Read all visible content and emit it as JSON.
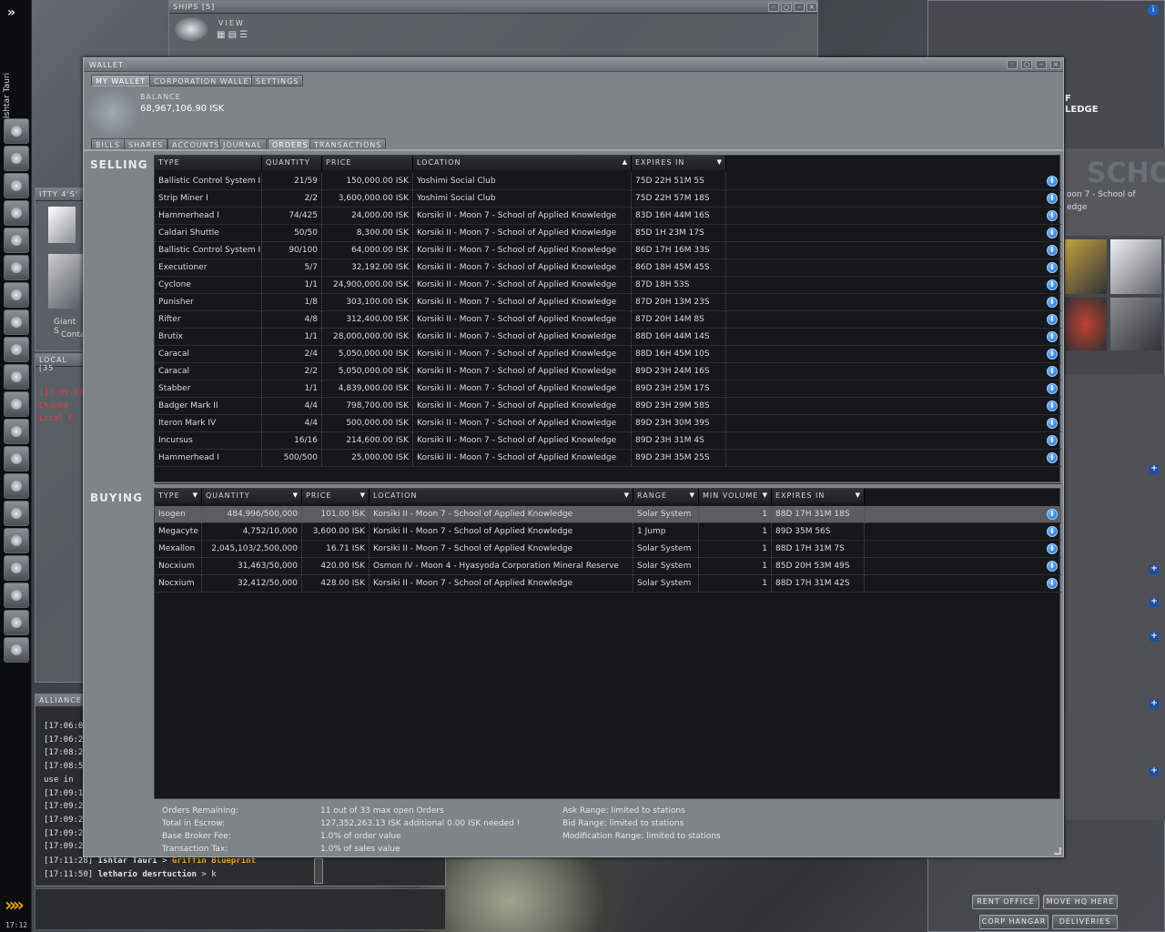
{
  "sidebar": {
    "expand_icon": "chevron-right-icon",
    "pilot_name": "Ishtar Tauri",
    "clock": "17:12"
  },
  "ships_window": {
    "title": "SHIPS [5]",
    "view_label": "VIEW"
  },
  "itty_panel": {
    "title": "ITTY 4'S'",
    "item_label": "Giant S",
    "item_label2": "Conta"
  },
  "local_panel": {
    "title": "LOCAL [35",
    "lines": [
      {
        "text": "[17:09:07",
        "color": "#e04040"
      },
      {
        "text": "Channe",
        "color": "#e04040"
      },
      {
        "text": "Local C",
        "color": "#e04040"
      }
    ]
  },
  "alliance_panel": {
    "title": "ALLIANCE",
    "lines": [
      "[17:06:07",
      "[17:06:27",
      "[17:08:24",
      "[17:08:55",
      "use in",
      "[17:09:14",
      "[17:09:20",
      "[17:09:21",
      "[17:09:24",
      "[17:09:26"
    ],
    "last1": {
      "time": "[17:11:28]",
      "who": "Ishtar Tauri",
      "arrow": ">",
      "msg": "Griffin Blueprint"
    },
    "last2": {
      "time": "[17:11:50]",
      "who": "letharío desrtuction",
      "arrow": ">",
      "msg": "k"
    }
  },
  "station_panel": {
    "title_line1": "F",
    "title_line2": "LEDGE",
    "location_line1": "oon 7 - School of",
    "location_line2": "edge",
    "bg_text": "SCHO"
  },
  "station_buttons": {
    "rent_office": "RENT OFFICE",
    "move_hq": "MOVE HQ HERE",
    "corp_hangar": "CORP HANGAR",
    "deliveries": "DELIVERIES"
  },
  "wallet": {
    "title": "WALLET",
    "top_tabs": [
      "MY WALLET",
      "CORPORATION WALLET",
      "SETTINGS"
    ],
    "balance_label": "BALANCE",
    "balance_value": "68,967,106.90 ISK",
    "sub_tabs": [
      "BILLS",
      "SHARES",
      "ACCOUNTS",
      "JOURNAL",
      "ORDERS",
      "TRANSACTIONS"
    ],
    "selling_label": "SELLING",
    "buying_label": "BUYING",
    "selling_headers": [
      "TYPE",
      "QUANTITY",
      "PRICE",
      "LOCATION",
      "EXPIRES IN"
    ],
    "buying_headers": [
      "TYPE",
      "QUANTITY",
      "PRICE",
      "LOCATION",
      "RANGE",
      "MIN VOLUME",
      "EXPIRES IN"
    ],
    "sell_orders": [
      [
        "Ballistic Control System I",
        "21/59",
        "150,000.00 ISK",
        "Yoshimi Social Club",
        "75D 22H 51M 5S"
      ],
      [
        "Strip Miner I",
        "2/2",
        "3,600,000.00 ISK",
        "Yoshimi Social Club",
        "75D 22H 57M 18S"
      ],
      [
        "Hammerhead I",
        "74/425",
        "24,000.00 ISK",
        "Korsiki II - Moon 7 - School of Applied Knowledge",
        "83D 16H 44M 16S"
      ],
      [
        "Caldari Shuttle",
        "50/50",
        "8,300.00 ISK",
        "Korsiki II - Moon 7 - School of Applied Knowledge",
        "85D 1H 23M 17S"
      ],
      [
        "Ballistic Control System I",
        "90/100",
        "64,000.00 ISK",
        "Korsiki II - Moon 7 - School of Applied Knowledge",
        "86D 17H 16M 33S"
      ],
      [
        "Executioner",
        "5/7",
        "32,192.00 ISK",
        "Korsiki II - Moon 7 - School of Applied Knowledge",
        "86D 18H 45M 45S"
      ],
      [
        "Cyclone",
        "1/1",
        "24,900,000.00 ISK",
        "Korsiki II - Moon 7 - School of Applied Knowledge",
        "87D 18H 53S"
      ],
      [
        "Punisher",
        "1/8",
        "303,100.00 ISK",
        "Korsiki II - Moon 7 - School of Applied Knowledge",
        "87D 20H 13M 23S"
      ],
      [
        "Rifter",
        "4/8",
        "312,400.00 ISK",
        "Korsiki II - Moon 7 - School of Applied Knowledge",
        "87D 20H 14M 8S"
      ],
      [
        "Brutix",
        "1/1",
        "28,000,000.00 ISK",
        "Korsiki II - Moon 7 - School of Applied Knowledge",
        "88D 16H 44M 14S"
      ],
      [
        "Caracal",
        "2/4",
        "5,050,000.00 ISK",
        "Korsiki II - Moon 7 - School of Applied Knowledge",
        "88D 16H 45M 10S"
      ],
      [
        "Caracal",
        "2/2",
        "5,050,000.00 ISK",
        "Korsiki II - Moon 7 - School of Applied Knowledge",
        "89D 23H 24M 16S"
      ],
      [
        "Stabber",
        "1/1",
        "4,839,000.00 ISK",
        "Korsiki II - Moon 7 - School of Applied Knowledge",
        "89D 23H 25M 17S"
      ],
      [
        "Badger Mark II",
        "4/4",
        "798,700.00 ISK",
        "Korsiki II - Moon 7 - School of Applied Knowledge",
        "89D 23H 29M 58S"
      ],
      [
        "Iteron Mark IV",
        "4/4",
        "500,000.00 ISK",
        "Korsiki II - Moon 7 - School of Applied Knowledge",
        "89D 23H 30M 39S"
      ],
      [
        "Incursus",
        "16/16",
        "214,600.00 ISK",
        "Korsiki II - Moon 7 - School of Applied Knowledge",
        "89D 23H 31M 4S"
      ],
      [
        "Hammerhead I",
        "500/500",
        "25,000.00 ISK",
        "Korsiki II - Moon 7 - School of Applied Knowledge",
        "89D 23H 35M 25S"
      ]
    ],
    "buy_orders": [
      [
        "Isogen",
        "484,996/500,000",
        "101.00 ISK",
        "Korsiki II - Moon 7 - School of Applied Knowledge",
        "Solar System",
        "1",
        "88D 17H 31M 18S"
      ],
      [
        "Megacyte",
        "4,752/10,000",
        "3,600.00 ISK",
        "Korsiki II - Moon 7 - School of Applied Knowledge",
        "1 Jump",
        "1",
        "89D 35M 56S"
      ],
      [
        "Mexallon",
        "2,045,103/2,500,000",
        "16.71 ISK",
        "Korsiki II - Moon 7 - School of Applied Knowledge",
        "Solar System",
        "1",
        "88D 17H 31M 7S"
      ],
      [
        "Nocxium",
        "31,463/50,000",
        "420.00 ISK",
        "Osmon IV - Moon 4 - Hyasyoda Corporation Mineral Reserve",
        "Solar System",
        "1",
        "85D 20H 53M 49S"
      ],
      [
        "Nocxium",
        "32,412/50,000",
        "428.00 ISK",
        "Korsiki II - Moon 7 - School of Applied Knowledge",
        "Solar System",
        "1",
        "88D 17H 31M 42S"
      ]
    ],
    "summary": {
      "orders_remaining_label": "Orders Remaining:",
      "orders_remaining": "11 out of 33 max open Orders",
      "escrow_label": "Total in Escrow:",
      "escrow": "127,352,263.13 ISK additional 0.00 ISK needed !",
      "broker_label": "Base Broker Fee:",
      "broker": "1.0% of order value",
      "tax_label": "Transaction Tax:",
      "tax": "1.0% of sales value",
      "ask_range": "Ask Range: limited to stations",
      "bid_range": "Bid Range: limited to stations",
      "mod_range": "Modification Range: limited to stations"
    }
  }
}
